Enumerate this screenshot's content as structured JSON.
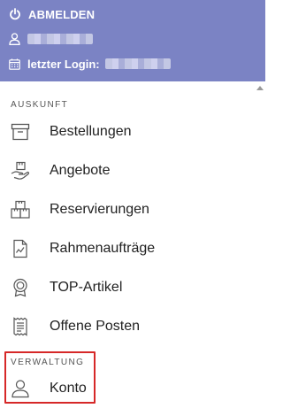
{
  "header": {
    "logout_label": "ABMELDEN",
    "last_login_label": "letzter Login:",
    "background_color": "#7b83c4"
  },
  "sections": [
    {
      "label": "AUSKUNFT",
      "items": [
        {
          "label": "Bestellungen",
          "icon": "archive-box-icon"
        },
        {
          "label": "Angebote",
          "icon": "hand-package-icon"
        },
        {
          "label": "Reservierungen",
          "icon": "stacked-boxes-icon"
        },
        {
          "label": "Rahmenaufträge",
          "icon": "document-chart-icon"
        },
        {
          "label": "TOP-Artikel",
          "icon": "award-badge-icon"
        },
        {
          "label": "Offene Posten",
          "icon": "receipt-icon"
        }
      ]
    },
    {
      "label": "VERWALTUNG",
      "items": [
        {
          "label": "Konto",
          "icon": "user-icon"
        }
      ]
    }
  ],
  "highlight_color": "#d62828"
}
